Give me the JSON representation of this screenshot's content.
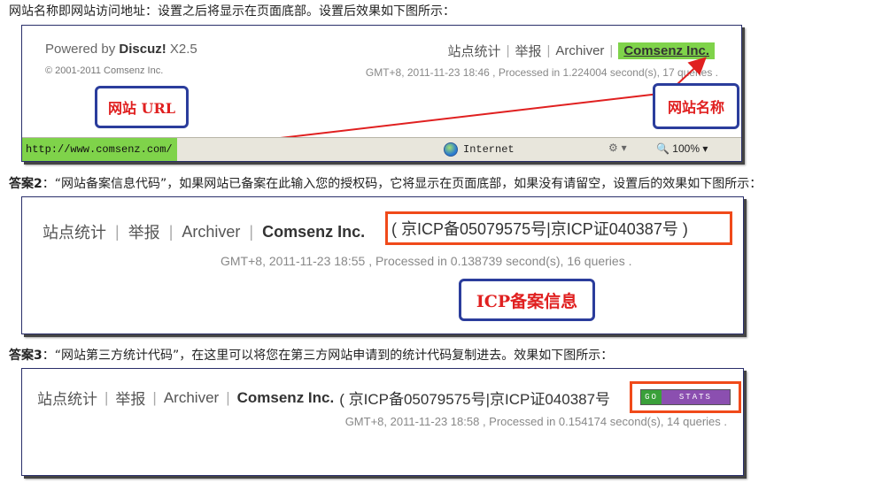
{
  "intro": "网站名称即网站访问地址：设置之后将显示在页面底部。设置后效果如下图所示：",
  "answer2": {
    "label": "答案2",
    "text": "：“网站备案信息代码”，如果网站已备案在此输入您的授权码，它将显示在页面底部，如果没有请留空，设置后的效果如下图所示："
  },
  "answer3": {
    "label": "答案3",
    "text": "：“网站第三方统计代码”，在这里可以将您在第三方网站申请到的统计代码复制进去。效果如下图所示："
  },
  "shot1": {
    "powered_prefix": "Powered by ",
    "powered_brand": "Discuz!",
    "powered_version": " X2.5",
    "copyright": "© 2001-2011 Comsenz Inc.",
    "nav": [
      "站点统计",
      "举报",
      "Archiver"
    ],
    "site_name": "Comsenz Inc.",
    "gmt": "GMT+8, 2011-11-23 18:46 , Processed in 1.224004 second(s), 17 queries .",
    "callout_url": "网站 URL",
    "callout_name": "网站名称",
    "status_url": "http://www.comsenz.com/",
    "zone": "Internet",
    "zoom": "100%",
    "colors": {
      "highlight": "#7fd34a",
      "callout_border": "#2b3d9c",
      "callout_text": "#e02020",
      "arrow": "#e02020"
    }
  },
  "shot2": {
    "nav": [
      "站点统计",
      "举报",
      "Archiver"
    ],
    "site_name": "Comsenz Inc.",
    "icp": "( 京ICP备05079575号|京ICP证040387号 )",
    "gmt": "GMT+8, 2011-11-23 18:55 , Processed in 0.138739 second(s), 16 queries .",
    "callout": "ICP备案信息",
    "colors": {
      "box": "#f04a1a"
    }
  },
  "shot3": {
    "nav": [
      "站点统计",
      "举报",
      "Archiver"
    ],
    "site_name": "Comsenz Inc.",
    "icp": "( 京ICP备05079575号|京ICP证040387号",
    "badge_go": "GO",
    "badge_stats": "STATS",
    "gmt": "GMT+8, 2011-11-23 18:58 , Processed in 0.154174 second(s), 14 queries .",
    "colors": {
      "box": "#f04a1a",
      "go": "#3aa03a",
      "stats": "#8b4fb0"
    }
  }
}
